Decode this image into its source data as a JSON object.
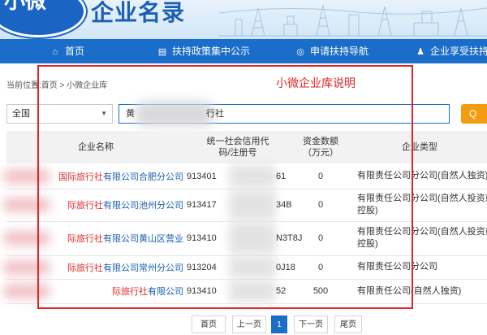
{
  "header": {
    "logo_text": "小微",
    "brand_title": "企业名录"
  },
  "nav": {
    "items": [
      {
        "label": "首页",
        "icon": "home-icon"
      },
      {
        "label": "扶持政策集中公示",
        "icon": "book-icon"
      },
      {
        "label": "申请扶持导航",
        "icon": "compass-icon"
      },
      {
        "label": "企业享受扶持信息",
        "icon": "user-icon"
      }
    ]
  },
  "breadcrumb": {
    "prefix": "当前位置:",
    "path": "首页 > 小微企业库"
  },
  "annotation": {
    "label": "小微企业库说明",
    "color": "#e22424"
  },
  "search": {
    "region_selected": "全国",
    "query_prefix": "黄",
    "query_suffix": "行社",
    "button_label": "Q"
  },
  "table": {
    "headers": [
      "企业名称",
      "统一社会信用代码/注册号",
      "资金数额（万元）",
      "企业类型"
    ],
    "rows": [
      {
        "name_prefix": "国际旅行社",
        "name_suffix": "有限公司合肥分公司",
        "code_prefix": "913401",
        "code_suffix": "61",
        "capital": "0",
        "type": "有限责任公司分公司(自然人独资)"
      },
      {
        "name_prefix": "际旅行社",
        "name_suffix": "有限公司池州分公司",
        "code_prefix": "913417",
        "code_suffix": "34B",
        "capital": "0",
        "type": "有限责任公司分公司(自然人投资或控股)"
      },
      {
        "name_prefix": "际旅行社",
        "name_suffix": "有限公司黄山区营业",
        "code_prefix": "913410",
        "code_suffix": "N3T8J",
        "capital": "0",
        "type": "有限责任公司分公司(自然人投资或控股)"
      },
      {
        "name_prefix": "际旅行社",
        "name_suffix": "有限公司常州分公司",
        "code_prefix": "913204",
        "code_suffix": "0J18",
        "capital": "0",
        "type": "有限责任公司分公司"
      },
      {
        "name_prefix": "际旅行社",
        "name_suffix": "有限公司",
        "code_prefix": "913410",
        "code_suffix": "52",
        "capital": "500",
        "type": "有限责任公司(自然人独资)"
      }
    ]
  },
  "pagination": {
    "first": "首页",
    "prev": "上一页",
    "current": "1",
    "next": "下一页",
    "last": "尾页"
  },
  "colors": {
    "nav_bg": "#1a6dc9",
    "link": "#1a5fb4",
    "highlight": "#e02b2b",
    "search_button": "#f39c12"
  }
}
